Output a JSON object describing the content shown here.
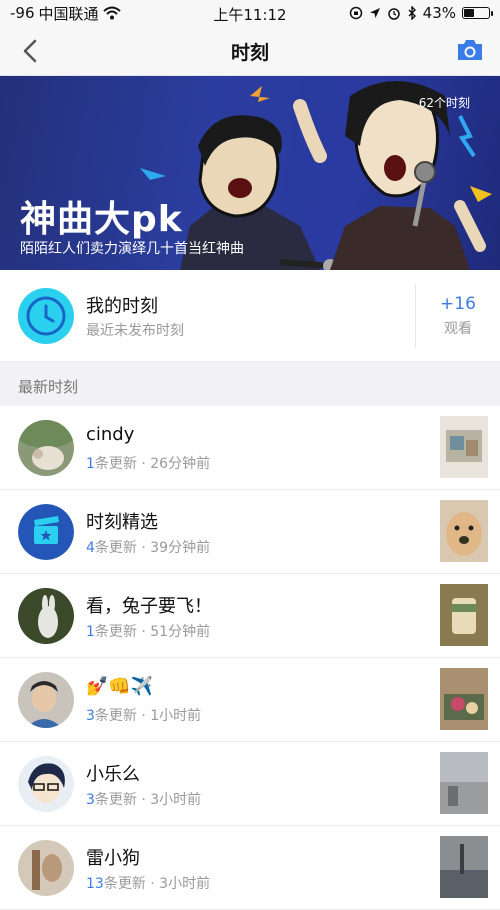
{
  "status_bar": {
    "signal": "-96",
    "carrier": "中国联通",
    "time": "上午11:12",
    "battery": "43%",
    "battery_level": 0.43
  },
  "nav": {
    "title": "时刻",
    "back_icon": "chevron-left-icon",
    "camera_icon": "camera-icon",
    "accent_color": "#3b7ce6"
  },
  "banner": {
    "count": "62个时刻",
    "title": "神曲大pk",
    "subtitle": "陌陌红人们卖力演绎几十首当红神曲"
  },
  "my_moments": {
    "title": "我的时刻",
    "subtitle": "最近未发布时刻",
    "watch_count": "+16",
    "watch_label": "观看"
  },
  "section": {
    "title": "最新时刻"
  },
  "feed": [
    {
      "name": "cindy",
      "count": "1",
      "meta": "条更新 · 26分钟前"
    },
    {
      "name": "时刻精选",
      "count": "4",
      "meta": "条更新 · 39分钟前"
    },
    {
      "name": "看，兔子要飞！",
      "count": "1",
      "meta": "条更新 · 51分钟前"
    },
    {
      "name": "💅👊✈️",
      "count": "3",
      "meta": "条更新 · 1小时前"
    },
    {
      "name": "小乐么",
      "count": "3",
      "meta": "条更新 · 3小时前"
    },
    {
      "name": "雷小狗",
      "count": "13",
      "meta": "条更新 · 3小时前"
    }
  ]
}
